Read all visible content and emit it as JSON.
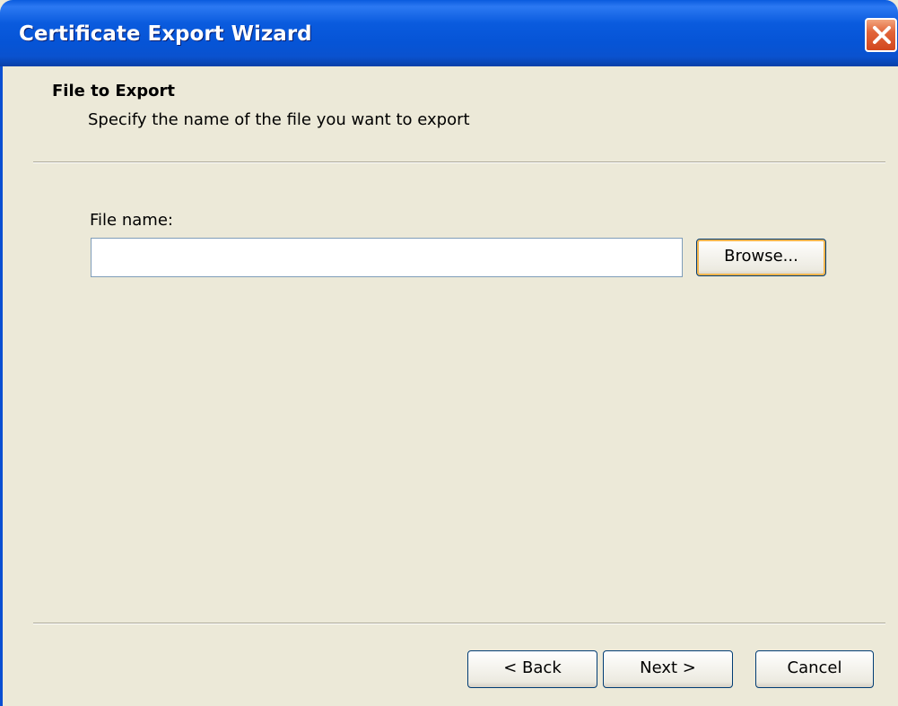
{
  "window": {
    "title": "Certificate Export Wizard"
  },
  "header": {
    "title": "File to Export",
    "subtitle": "Specify the name of the file you want to export"
  },
  "form": {
    "file_name_label": "File name:",
    "file_name_value": "",
    "file_name_placeholder": "",
    "browse_label": "Browse..."
  },
  "footer": {
    "back_label": "< Back",
    "next_label": "Next >",
    "cancel_label": "Cancel"
  },
  "icons": {
    "close": "close-icon"
  },
  "colors": {
    "titlebar": "#0A5BDE",
    "dialog_bg": "#ECE9D8",
    "close_button": "#E2653A",
    "button_border": "#003C74",
    "focus_highlight": "#F2B54E"
  }
}
